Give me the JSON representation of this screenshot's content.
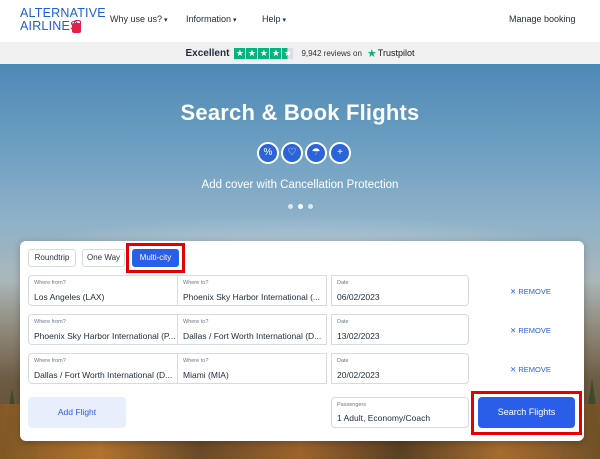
{
  "header": {
    "logo_line1": "ALTERNATIVE",
    "logo_line2": "AIRLINES",
    "nav": [
      {
        "label": "Why use us?"
      },
      {
        "label": "Information"
      },
      {
        "label": "Help"
      }
    ],
    "manage_label": "Manage booking"
  },
  "trustpilot": {
    "rating_word": "Excellent",
    "stars": 4.5,
    "reviews": "9,942 reviews on",
    "brand": "Trustpilot",
    "color": "#00b67a"
  },
  "hero": {
    "title": "Search & Book Flights",
    "icons": [
      "percent-icon",
      "heart-icon",
      "umbrella-icon",
      "plus-icon"
    ],
    "subtitle": "Add cover with Cancellation Protection",
    "slides": 3,
    "active_slide": 2
  },
  "search": {
    "trip_types": [
      "Roundtrip",
      "One Way",
      "Multi-city"
    ],
    "selected_trip_type": "Multi-city",
    "legs": [
      {
        "from_label": "Where from?",
        "from": "Los Angeles (LAX)",
        "to_label": "Where to?",
        "to": "Phoenix Sky Harbor International (...",
        "date_label": "Date",
        "date": "06/02/2023",
        "remove": "REMOVE"
      },
      {
        "from_label": "Where from?",
        "from": "Phoenix Sky Harbor International (P...",
        "to_label": "Where to?",
        "to": "Dallas / Fort Worth International (D...",
        "date_label": "Date",
        "date": "13/02/2023",
        "remove": "REMOVE"
      },
      {
        "from_label": "Where from?",
        "from": "Dallas / Fort Worth International (D...",
        "to_label": "Where to?",
        "to": "Miami (MIA)",
        "date_label": "Date",
        "date": "20/02/2023",
        "remove": "REMOVE"
      }
    ],
    "add_flight_label": "Add Flight",
    "passengers_label": "Passengers",
    "passengers_value": "1 Adult, Economy/Coach",
    "search_button": "Search Flights",
    "accent_color": "#2a5ee8",
    "highlight_color": "#e40000"
  }
}
